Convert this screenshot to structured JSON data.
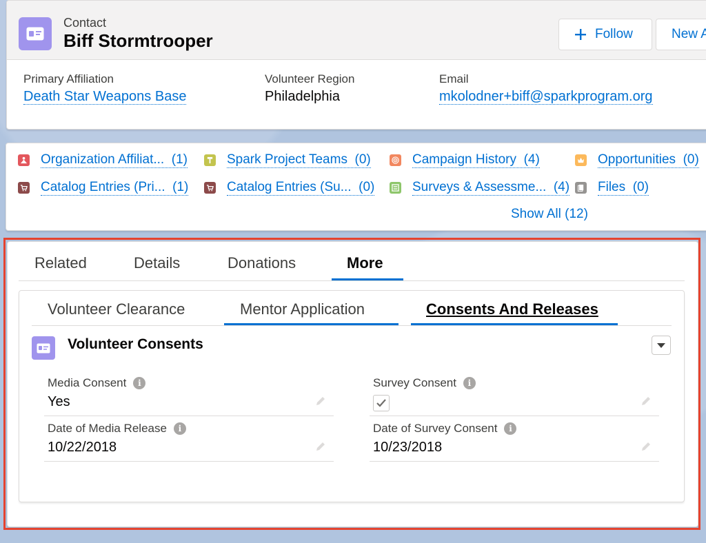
{
  "header": {
    "object_type": "Contact",
    "record_name": "Biff Stormtrooper",
    "follow_label": "Follow",
    "new_label": "New A",
    "fields": [
      {
        "label": "Primary Affiliation",
        "value": "Death Star Weapons Base"
      },
      {
        "label": "Volunteer Region",
        "value": "Philadelphia"
      },
      {
        "label": "Email",
        "value": "mkolodner+biff@sparkprogram.org"
      }
    ]
  },
  "quick_links": {
    "items": [
      {
        "label": "Organization Affiliat...",
        "count": "(1)",
        "icon": "affiliation-icon",
        "color": "#e3575d"
      },
      {
        "label": "Spark Project Teams",
        "count": "(0)",
        "icon": "project-team-icon",
        "color": "#c3c44e"
      },
      {
        "label": "Campaign History",
        "count": "(4)",
        "icon": "campaign-icon",
        "color": "#f2875f"
      },
      {
        "label": "Opportunities",
        "count": "(0)",
        "icon": "opportunity-icon",
        "color": "#fcb95b"
      },
      {
        "label": "Catalog Entries (Pri...",
        "count": "(1)",
        "icon": "catalog-icon",
        "color": "#8c4a4a"
      },
      {
        "label": "Catalog Entries (Su...",
        "count": "(0)",
        "icon": "catalog-icon",
        "color": "#8c4a4a"
      },
      {
        "label": "Surveys & Assessme...",
        "count": "(4)",
        "icon": "survey-icon",
        "color": "#8ec66b"
      },
      {
        "label": "Files",
        "count": "(0)",
        "icon": "files-icon",
        "color": "#969492"
      }
    ],
    "show_all": "Show All (12)"
  },
  "tabs": {
    "items": [
      "Related",
      "Details",
      "Donations",
      "More"
    ],
    "active": "More"
  },
  "subtabs": {
    "items": [
      "Volunteer Clearance",
      "Mentor Application",
      "Consents And Releases"
    ],
    "active": "Consents And Releases"
  },
  "section": {
    "title": "Volunteer Consents",
    "fields": {
      "media_consent": {
        "label": "Media Consent",
        "value": "Yes"
      },
      "survey_consent": {
        "label": "Survey Consent",
        "checked": true
      },
      "media_release": {
        "label": "Date of Media Release",
        "value": "10/22/2018"
      },
      "survey_consent_date": {
        "label": "Date of Survey Consent",
        "value": "10/23/2018"
      }
    }
  },
  "colors": {
    "brand_link": "#0070d2",
    "contact_icon": "#a094ed",
    "highlight_frame": "#e5432f"
  }
}
